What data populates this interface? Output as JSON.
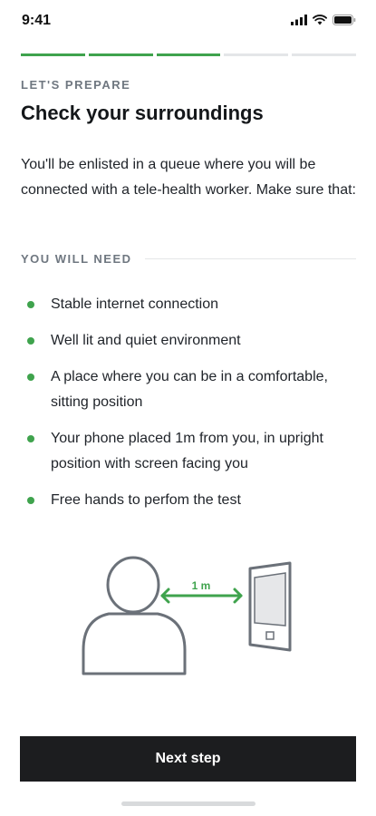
{
  "status_bar": {
    "time": "9:41",
    "icons": [
      "signal-icon",
      "wifi-icon",
      "battery-icon"
    ]
  },
  "progress": {
    "steps": [
      {
        "fill": 1.0
      },
      {
        "fill": 1.0
      },
      {
        "fill": 1.0
      },
      {
        "fill": 0.0
      },
      {
        "fill": 0.0
      }
    ],
    "active_color": "#3fa34d",
    "inactive_color": "#e4e6e8"
  },
  "header": {
    "eyebrow": "LET'S PREPARE",
    "title": "Check your surroundings"
  },
  "intro": "You'll be enlisted in a queue where you will be connected with a tele-health worker. Make sure that:",
  "section": {
    "label": "YOU WILL NEED"
  },
  "needs": [
    "Stable internet connection",
    "Well lit and quiet environment",
    "A place where you can be in a comfortable, sitting position",
    "Your phone placed 1m from you, in upright position with screen facing you",
    "Free hands to perfom the test"
  ],
  "illustration": {
    "distance_label": "1 m",
    "accent_color": "#3fa34d"
  },
  "cta": {
    "label": "Next step"
  }
}
